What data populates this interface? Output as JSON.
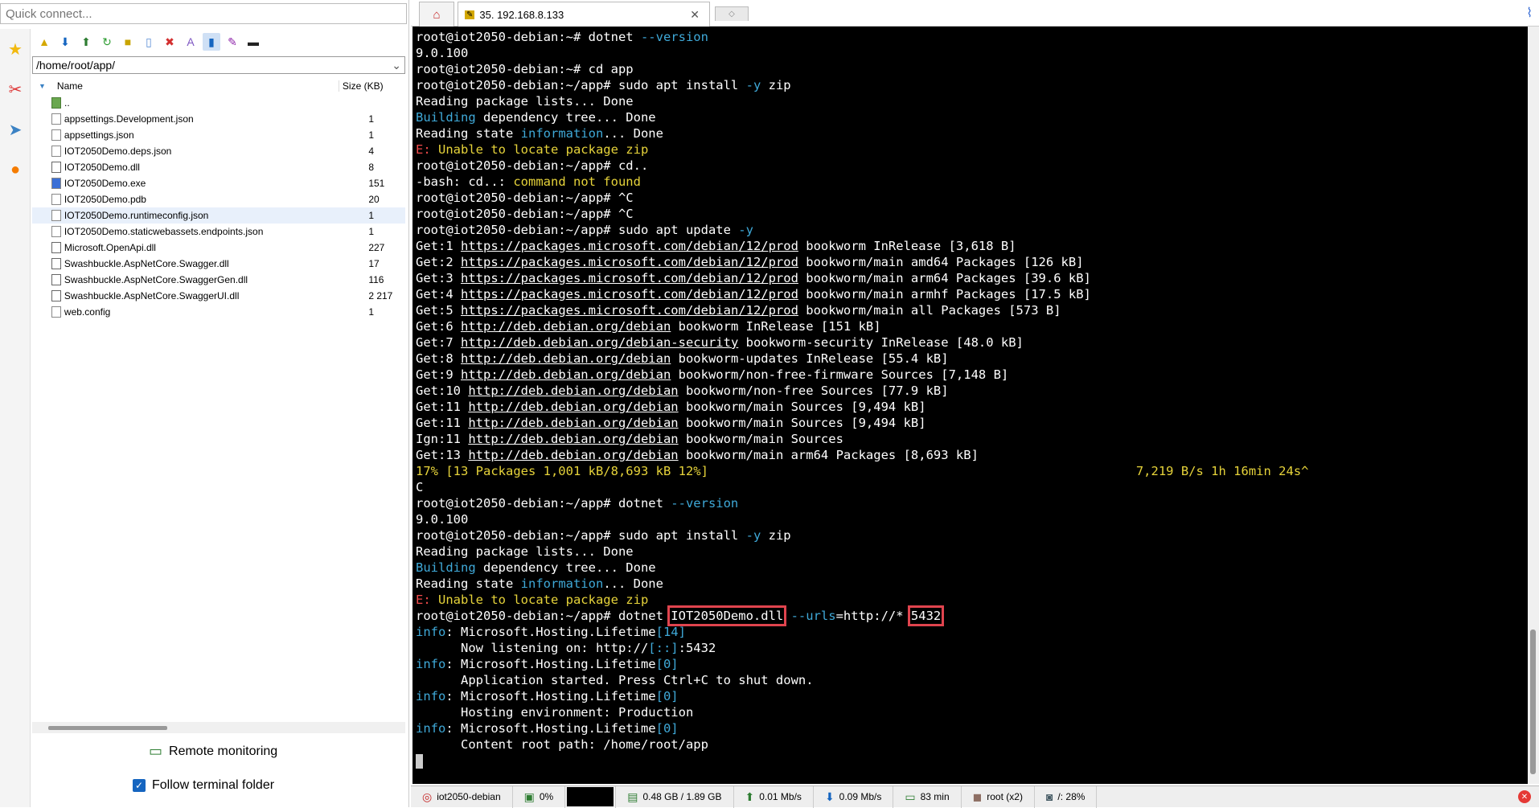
{
  "quick_connect": {
    "placeholder": "Quick connect..."
  },
  "sidebar": {
    "icons": [
      "star-icon",
      "tools-icon",
      "paper-plane-icon",
      "globe-icon"
    ]
  },
  "file_toolbar": {
    "icons": [
      "up-folder-icon",
      "download-icon",
      "upload-icon",
      "refresh-icon",
      "new-folder-icon",
      "new-file-icon",
      "delete-icon",
      "rename-icon",
      "follow-folder-icon",
      "edit-icon",
      "terminal-icon"
    ]
  },
  "path": {
    "value": "/home/root/app/"
  },
  "file_list": {
    "col_name": "Name",
    "col_size": "Size (KB)",
    "parent": "..",
    "files": [
      {
        "name": "appsettings.Development.json",
        "size": "1",
        "icon": "json-file-icon"
      },
      {
        "name": "appsettings.json",
        "size": "1",
        "icon": "json-file-icon"
      },
      {
        "name": "IOT2050Demo.deps.json",
        "size": "4",
        "icon": "json-file-icon"
      },
      {
        "name": "IOT2050Demo.dll",
        "size": "8",
        "icon": "dll-file-icon"
      },
      {
        "name": "IOT2050Demo.exe",
        "size": "151",
        "icon": "exe-file-icon"
      },
      {
        "name": "IOT2050Demo.pdb",
        "size": "20",
        "icon": "file-icon"
      },
      {
        "name": "IOT2050Demo.runtimeconfig.json",
        "size": "1",
        "icon": "json-file-icon",
        "selected": true
      },
      {
        "name": "IOT2050Demo.staticwebassets.endpoints.json",
        "size": "1",
        "icon": "json-file-icon"
      },
      {
        "name": "Microsoft.OpenApi.dll",
        "size": "227",
        "icon": "dll-file-icon"
      },
      {
        "name": "Swashbuckle.AspNetCore.Swagger.dll",
        "size": "17",
        "icon": "dll-file-icon"
      },
      {
        "name": "Swashbuckle.AspNetCore.SwaggerGen.dll",
        "size": "116",
        "icon": "dll-file-icon"
      },
      {
        "name": "Swashbuckle.AspNetCore.SwaggerUI.dll",
        "size": "2 217",
        "icon": "dll-file-icon"
      },
      {
        "name": "web.config",
        "size": "1",
        "icon": "config-file-icon"
      }
    ]
  },
  "remote_monitoring": {
    "label": "Remote monitoring"
  },
  "follow_folder": {
    "label": "Follow terminal folder",
    "checked": true
  },
  "tabs": {
    "active_label": "35. 192.168.8.133"
  },
  "terminal": {
    "lines": [
      [
        {
          "t": "root@iot2050-debian:~# dotnet "
        },
        {
          "t": "--version",
          "c": "c"
        }
      ],
      [
        {
          "t": "9.0.100"
        }
      ],
      [
        {
          "t": "root@iot2050-debian:~# cd app"
        }
      ],
      [
        {
          "t": "root@iot2050-debian:~/app# sudo apt install "
        },
        {
          "t": "-y",
          "c": "c"
        },
        {
          "t": " zip"
        }
      ],
      [
        {
          "t": "Reading package lists... Done"
        }
      ],
      [
        {
          "t": "Building",
          "c": "c"
        },
        {
          "t": " dependency tree... Done"
        }
      ],
      [
        {
          "t": "Reading state "
        },
        {
          "t": "information",
          "c": "c"
        },
        {
          "t": "... Done"
        }
      ],
      [
        {
          "t": "E:",
          "c": "r"
        },
        {
          "t": " Unable to locate package zip",
          "c": "y"
        }
      ],
      [
        {
          "t": "root@iot2050-debian:~/app# cd.."
        }
      ],
      [
        {
          "t": "-bash: cd..: "
        },
        {
          "t": "command not found",
          "c": "y"
        }
      ],
      [
        {
          "t": "root@iot2050-debian:~/app# ^C"
        }
      ],
      [
        {
          "t": "root@iot2050-debian:~/app# ^C"
        }
      ],
      [
        {
          "t": "root@iot2050-debian:~/app# sudo apt update "
        },
        {
          "t": "-y",
          "c": "c"
        }
      ],
      [
        {
          "t": "Get:1 "
        },
        {
          "t": "https://packages.microsoft.com/debian/12/prod",
          "c": "u"
        },
        {
          "t": " bookworm InRelease [3,618 B]"
        }
      ],
      [
        {
          "t": "Get:2 "
        },
        {
          "t": "https://packages.microsoft.com/debian/12/prod",
          "c": "u"
        },
        {
          "t": " bookworm/main amd64 Packages [126 kB]"
        }
      ],
      [
        {
          "t": "Get:3 "
        },
        {
          "t": "https://packages.microsoft.com/debian/12/prod",
          "c": "u"
        },
        {
          "t": " bookworm/main arm64 Packages [39.6 kB]"
        }
      ],
      [
        {
          "t": "Get:4 "
        },
        {
          "t": "https://packages.microsoft.com/debian/12/prod",
          "c": "u"
        },
        {
          "t": " bookworm/main armhf Packages [17.5 kB]"
        }
      ],
      [
        {
          "t": "Get:5 "
        },
        {
          "t": "https://packages.microsoft.com/debian/12/prod",
          "c": "u"
        },
        {
          "t": " bookworm/main all Packages [573 B]"
        }
      ],
      [
        {
          "t": "Get:6 "
        },
        {
          "t": "http://deb.debian.org/debian",
          "c": "u"
        },
        {
          "t": " bookworm InRelease [151 kB]"
        }
      ],
      [
        {
          "t": "Get:7 "
        },
        {
          "t": "http://deb.debian.org/debian-security",
          "c": "u"
        },
        {
          "t": " bookworm-security InRelease [48.0 kB]"
        }
      ],
      [
        {
          "t": "Get:8 "
        },
        {
          "t": "http://deb.debian.org/debian",
          "c": "u"
        },
        {
          "t": " bookworm-updates InRelease [55.4 kB]"
        }
      ],
      [
        {
          "t": "Get:9 "
        },
        {
          "t": "http://deb.debian.org/debian",
          "c": "u"
        },
        {
          "t": " bookworm/non-free-firmware Sources [7,148 B]"
        }
      ],
      [
        {
          "t": "Get:10 "
        },
        {
          "t": "http://deb.debian.org/debian",
          "c": "u"
        },
        {
          "t": " bookworm/non-free Sources [77.9 kB]"
        }
      ],
      [
        {
          "t": "Get:11 "
        },
        {
          "t": "http://deb.debian.org/debian",
          "c": "u"
        },
        {
          "t": " bookworm/main Sources [9,494 kB]"
        }
      ],
      [
        {
          "t": "Get:11 "
        },
        {
          "t": "http://deb.debian.org/debian",
          "c": "u"
        },
        {
          "t": " bookworm/main Sources [9,494 kB]"
        }
      ],
      [
        {
          "t": "Ign:11 "
        },
        {
          "t": "http://deb.debian.org/debian",
          "c": "u"
        },
        {
          "t": " bookworm/main Sources"
        }
      ],
      [
        {
          "t": "Get:13 "
        },
        {
          "t": "http://deb.debian.org/debian",
          "c": "u"
        },
        {
          "t": " bookworm/main arm64 Packages [8,693 kB]"
        }
      ],
      [
        {
          "t": "17% [13 Packages 1,001 kB/8,693 kB 12%]                                                         7,219 B/s 1h 16min 24s^",
          "c": "y"
        }
      ],
      [
        {
          "t": "C"
        }
      ],
      [
        {
          "t": "root@iot2050-debian:~/app# dotnet "
        },
        {
          "t": "--version",
          "c": "c"
        }
      ],
      [
        {
          "t": "9.0.100"
        }
      ],
      [
        {
          "t": "root@iot2050-debian:~/app# sudo apt install "
        },
        {
          "t": "-y",
          "c": "c"
        },
        {
          "t": " zip"
        }
      ],
      [
        {
          "t": "Reading package lists... Done"
        }
      ],
      [
        {
          "t": "Building",
          "c": "c"
        },
        {
          "t": " dependency tree... Done"
        }
      ],
      [
        {
          "t": "Reading state "
        },
        {
          "t": "information",
          "c": "c"
        },
        {
          "t": "... Done"
        }
      ],
      [
        {
          "t": "E:",
          "c": "r"
        },
        {
          "t": " Unable to locate package zip",
          "c": "y"
        }
      ],
      [
        {
          "t": "root@iot2050-debian:~/app# dotnet "
        },
        {
          "t": "IOT2050Demo.dll",
          "c": "box"
        },
        {
          "t": " --urls",
          "c": "c"
        },
        {
          "t": "=http://* "
        },
        {
          "t": "5432",
          "c": "box"
        }
      ],
      [
        {
          "t": "info",
          "c": "c"
        },
        {
          "t": ": Microsoft.Hosting.Lifetime"
        },
        {
          "t": "[14]",
          "c": "c"
        }
      ],
      [
        {
          "t": "      Now listening on: http://"
        },
        {
          "t": "[::]",
          "c": "c"
        },
        {
          "t": ":5432"
        }
      ],
      [
        {
          "t": "info",
          "c": "c"
        },
        {
          "t": ": Microsoft.Hosting.Lifetime"
        },
        {
          "t": "[0]",
          "c": "c"
        }
      ],
      [
        {
          "t": "      Application started. Press Ctrl+C to shut down."
        }
      ],
      [
        {
          "t": "info",
          "c": "c"
        },
        {
          "t": ": Microsoft.Hosting.Lifetime"
        },
        {
          "t": "[0]",
          "c": "c"
        }
      ],
      [
        {
          "t": "      Hosting environment: Production"
        }
      ],
      [
        {
          "t": "info",
          "c": "c"
        },
        {
          "t": ": Microsoft.Hosting.Lifetime"
        },
        {
          "t": "[0]",
          "c": "c"
        }
      ],
      [
        {
          "t": "      Content root path: /home/root/app"
        }
      ]
    ]
  },
  "status_bar": {
    "host": "iot2050-debian",
    "cpu": "0%",
    "memory": "0.48 GB / 1.89 GB",
    "upload": "0.01 Mb/s",
    "download": "0.09 Mb/s",
    "uptime": "83 min",
    "users": "root (x2)",
    "disk": "/: 28%"
  }
}
